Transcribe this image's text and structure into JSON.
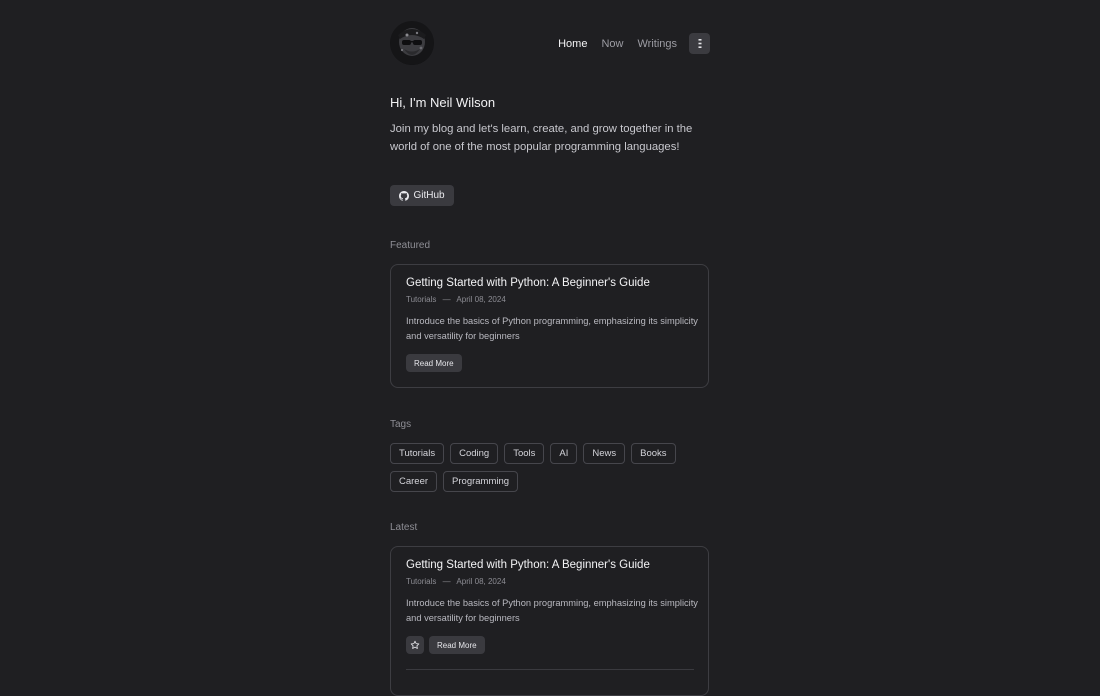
{
  "nav": {
    "items": [
      {
        "label": "Home",
        "active": true
      },
      {
        "label": "Now",
        "active": false
      },
      {
        "label": "Writings",
        "active": false
      }
    ]
  },
  "intro": {
    "heading": "Hi, I'm Neil Wilson",
    "text": "Join my blog and let's learn, create, and grow together in the world of one of the most popular programming languages!",
    "github_label": "GitHub"
  },
  "featured": {
    "section_label": "Featured",
    "post": {
      "title": "Getting Started with Python: A Beginner's Guide",
      "category": "Tutorials",
      "separator": "—",
      "date": "April 08, 2024",
      "description": "Introduce the basics of Python programming, emphasizing its simplicity and versatility for beginners",
      "read_more": "Read More"
    }
  },
  "tags": {
    "section_label": "Tags",
    "items": [
      "Tutorials",
      "Coding",
      "Tools",
      "AI",
      "News",
      "Books",
      "Career",
      "Programming"
    ]
  },
  "latest": {
    "section_label": "Latest",
    "post": {
      "title": "Getting Started with Python: A Beginner's Guide",
      "category": "Tutorials",
      "separator": "—",
      "date": "April 08, 2024",
      "description": "Introduce the basics of Python programming, emphasizing its simplicity and versatility for beginners",
      "read_more": "Read More"
    }
  },
  "icons": {
    "github": "github-icon",
    "menu": "menu-dots-icon",
    "star": "star-icon"
  },
  "colors": {
    "background": "#1f1f22",
    "card_border": "#3d3d42",
    "button_bg": "#3a3a3f",
    "text_primary": "#f4f4f6",
    "text_muted": "#8e8e95"
  }
}
